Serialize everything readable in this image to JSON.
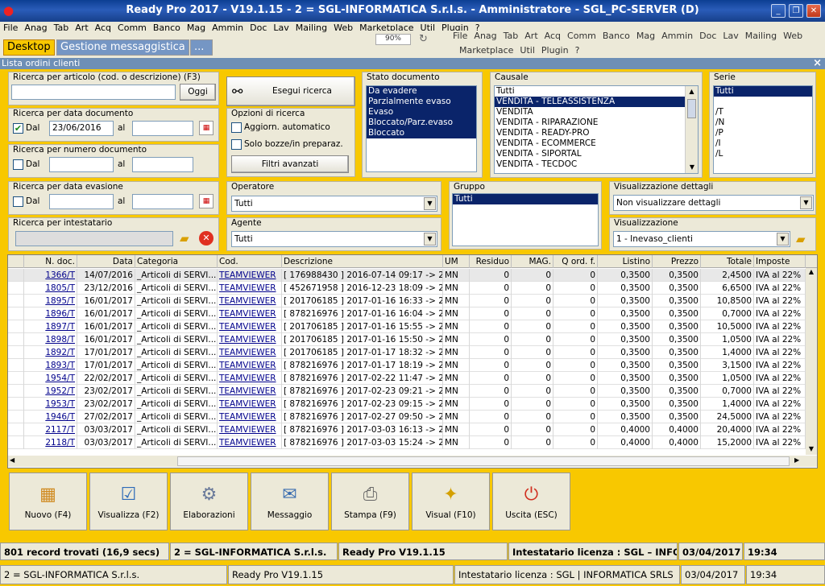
{
  "window": {
    "title": "Ready Pro 2017 - V19.1.15 - 2 = SGL-INFORMATICA S.r.l.s. - Amministratore - SGL_PC-SERVER (D)"
  },
  "menu": [
    "File",
    "Anag",
    "Tab",
    "Art",
    "Acq",
    "Comm",
    "Banco",
    "Mag",
    "Ammin",
    "Doc",
    "Lav",
    "Mailing",
    "Web",
    "Marketplace",
    "Util",
    "Plugin",
    "?"
  ],
  "tabs": {
    "desktop": "Desktop",
    "messaggistica": "Gestione messaggistica",
    "more": "..."
  },
  "inner": {
    "zoom": "90%",
    "menu_row1": [
      "File",
      "Anag",
      "Tab",
      "Art",
      "Acq",
      "Comm",
      "Banco",
      "Mag",
      "Ammin",
      "Doc",
      "Lav",
      "Mailing",
      "Web"
    ],
    "menu_row2": [
      "Marketplace",
      "Util",
      "Plugin",
      "?"
    ]
  },
  "panel": {
    "title": "Lista ordini clienti",
    "close": "×"
  },
  "search": {
    "articolo_label": "Ricerca per articolo (cod. o descrizione) (F3)",
    "articolo_value": "",
    "oggi": "Oggi",
    "data_doc_label": "Ricerca per data documento",
    "dal": "Dal",
    "al": "al",
    "data_doc_dal": "23/06/2016",
    "data_doc_al": "",
    "num_doc_label": "Ricerca per numero documento",
    "data_evas_label": "Ricerca per data evasione",
    "intestatario_label": "Ricerca per intestatario"
  },
  "esegui": "Esegui ricerca",
  "opzioni": {
    "label": "Opzioni di ricerca",
    "aggiorn": "Aggiorn. automatico",
    "bozze": "Solo bozze/in preparaz.",
    "filtri": "Filtri avanzati"
  },
  "stato": {
    "label": "Stato documento",
    "items": [
      "Da evadere",
      "Parzialmente evaso",
      "Evaso",
      "Bloccato/Parz.evaso",
      "Bloccato"
    ]
  },
  "causale": {
    "label": "Causale",
    "items": [
      "Tutti",
      "VENDITA - TELEASSISTENZA",
      "VENDITA",
      "VENDITA - RIPARAZIONE",
      "VENDITA - READY-PRO",
      "VENDITA - ECOMMERCE",
      "VENDITA - SIPORTAL",
      "VENDITA - TECDOC"
    ]
  },
  "serie": {
    "label": "Serie",
    "items": [
      "Tutti",
      "",
      "/T",
      "/N",
      "/P",
      "/I",
      "/L"
    ]
  },
  "operatore": {
    "label": "Operatore",
    "value": "Tutti"
  },
  "agente": {
    "label": "Agente",
    "value": "Tutti"
  },
  "gruppo": {
    "label": "Gruppo",
    "items": [
      "Tutti"
    ]
  },
  "vis_dettagli": {
    "label": "Visualizzazione dettagli",
    "value": "Non visualizzare dettagli"
  },
  "visualizzazione": {
    "label": "Visualizzazione",
    "value": "1 - Inevaso_clienti"
  },
  "table": {
    "headers": [
      "N. doc.",
      "Data",
      "Categoria",
      "Cod.",
      "Descrizione",
      "UM",
      "Residuo",
      "MAG.",
      "Q ord. f.",
      "Listino",
      "Prezzo",
      "Totale",
      "Imposte"
    ],
    "rows": [
      [
        "1366/T",
        "14/07/2016",
        "_Articoli di SERVI...",
        "TEAMVIEWER",
        "[ 176988430 ] 2016-07-14 09:17 -> 2...",
        "MN",
        "0",
        "0",
        "0",
        "0,3500",
        "0,3500",
        "2,4500",
        "IVA al 22%"
      ],
      [
        "1805/T",
        "23/12/2016",
        "_Articoli di SERVI...",
        "TEAMVIEWER",
        "[ 452671958 ] 2016-12-23 18:09 -> 2...",
        "MN",
        "0",
        "0",
        "0",
        "0,3500",
        "0,3500",
        "6,6500",
        "IVA al 22%"
      ],
      [
        "1895/T",
        "16/01/2017",
        "_Articoli di SERVI...",
        "TEAMVIEWER",
        "[ 201706185 ] 2017-01-16 16:33 -> 2...",
        "MN",
        "0",
        "0",
        "0",
        "0,3500",
        "0,3500",
        "10,8500",
        "IVA al 22%"
      ],
      [
        "1896/T",
        "16/01/2017",
        "_Articoli di SERVI...",
        "TEAMVIEWER",
        "[ 878216976 ] 2017-01-16 16:04 -> 2...",
        "MN",
        "0",
        "0",
        "0",
        "0,3500",
        "0,3500",
        "0,7000",
        "IVA al 22%"
      ],
      [
        "1897/T",
        "16/01/2017",
        "_Articoli di SERVI...",
        "TEAMVIEWER",
        "[ 201706185 ] 2017-01-16 15:55 -> 2...",
        "MN",
        "0",
        "0",
        "0",
        "0,3500",
        "0,3500",
        "10,5000",
        "IVA al 22%"
      ],
      [
        "1898/T",
        "16/01/2017",
        "_Articoli di SERVI...",
        "TEAMVIEWER",
        "[ 201706185 ] 2017-01-16 15:50 -> 2...",
        "MN",
        "0",
        "0",
        "0",
        "0,3500",
        "0,3500",
        "1,0500",
        "IVA al 22%"
      ],
      [
        "1892/T",
        "17/01/2017",
        "_Articoli di SERVI...",
        "TEAMVIEWER",
        "[ 201706185 ] 2017-01-17 18:32 -> 2...",
        "MN",
        "0",
        "0",
        "0",
        "0,3500",
        "0,3500",
        "1,4000",
        "IVA al 22%"
      ],
      [
        "1893/T",
        "17/01/2017",
        "_Articoli di SERVI...",
        "TEAMVIEWER",
        "[ 878216976 ] 2017-01-17 18:19 -> 2...",
        "MN",
        "0",
        "0",
        "0",
        "0,3500",
        "0,3500",
        "3,1500",
        "IVA al 22%"
      ],
      [
        "1954/T",
        "22/02/2017",
        "_Articoli di SERVI...",
        "TEAMVIEWER",
        "[ 878216976 ] 2017-02-22 11:47 -> 2...",
        "MN",
        "0",
        "0",
        "0",
        "0,3500",
        "0,3500",
        "1,0500",
        "IVA al 22%"
      ],
      [
        "1952/T",
        "23/02/2017",
        "_Articoli di SERVI...",
        "TEAMVIEWER",
        "[ 878216976 ] 2017-02-23 09:21 -> 2...",
        "MN",
        "0",
        "0",
        "0",
        "0,3500",
        "0,3500",
        "0,7000",
        "IVA al 22%"
      ],
      [
        "1953/T",
        "23/02/2017",
        "_Articoli di SERVI...",
        "TEAMVIEWER",
        "[ 878216976 ] 2017-02-23 09:15 -> 2...",
        "MN",
        "0",
        "0",
        "0",
        "0,3500",
        "0,3500",
        "1,4000",
        "IVA al 22%"
      ],
      [
        "1946/T",
        "27/02/2017",
        "_Articoli di SERVI...",
        "TEAMVIEWER",
        "[ 878216976 ] 2017-02-27 09:50 -> 2...",
        "MN",
        "0",
        "0",
        "0",
        "0,3500",
        "0,3500",
        "24,5000",
        "IVA al 22%"
      ],
      [
        "2117/T",
        "03/03/2017",
        "_Articoli di SERVI...",
        "TEAMVIEWER",
        "[ 878216976 ] 2017-03-03 16:13 -> 2...",
        "MN",
        "0",
        "0",
        "0",
        "0,4000",
        "0,4000",
        "20,4000",
        "IVA al 22%"
      ],
      [
        "2118/T",
        "03/03/2017",
        "_Articoli di SERVI...",
        "TEAMVIEWER",
        "[ 878216976 ] 2017-03-03 15:24 -> 2...",
        "MN",
        "0",
        "0",
        "0",
        "0,4000",
        "0,4000",
        "15,2000",
        "IVA al 22%"
      ]
    ]
  },
  "buttons": [
    {
      "label": "Nuovo (F4)",
      "icon": "new-document-icon"
    },
    {
      "label": "Visualizza (F2)",
      "icon": "view-icon"
    },
    {
      "label": "Elaborazioni",
      "icon": "process-icon"
    },
    {
      "label": "Messaggio",
      "icon": "message-icon"
    },
    {
      "label": "Stampa (F9)",
      "icon": "printer-icon"
    },
    {
      "label": "Visual (F10)",
      "icon": "magic-wand-icon"
    },
    {
      "label": "Uscita (ESC)",
      "icon": "exit-icon"
    }
  ],
  "status": {
    "records": "801 record trovati (16,9 secs)",
    "company": "2 = SGL-INFORMATICA S.r.l.s.",
    "version": "Ready Pro V19.1.15",
    "licenza": "Intestatario licenza : SGL – INFORMA",
    "date": "03/04/2017",
    "time": "19:34"
  },
  "status2": {
    "company": "2 = SGL-INFORMATICA S.r.l.s.",
    "version": "Ready Pro V19.1.15",
    "licenza": "Intestatario licenza : SGL | INFORMATICA SRLS",
    "date": "03/04/2017",
    "time": "19:34"
  }
}
